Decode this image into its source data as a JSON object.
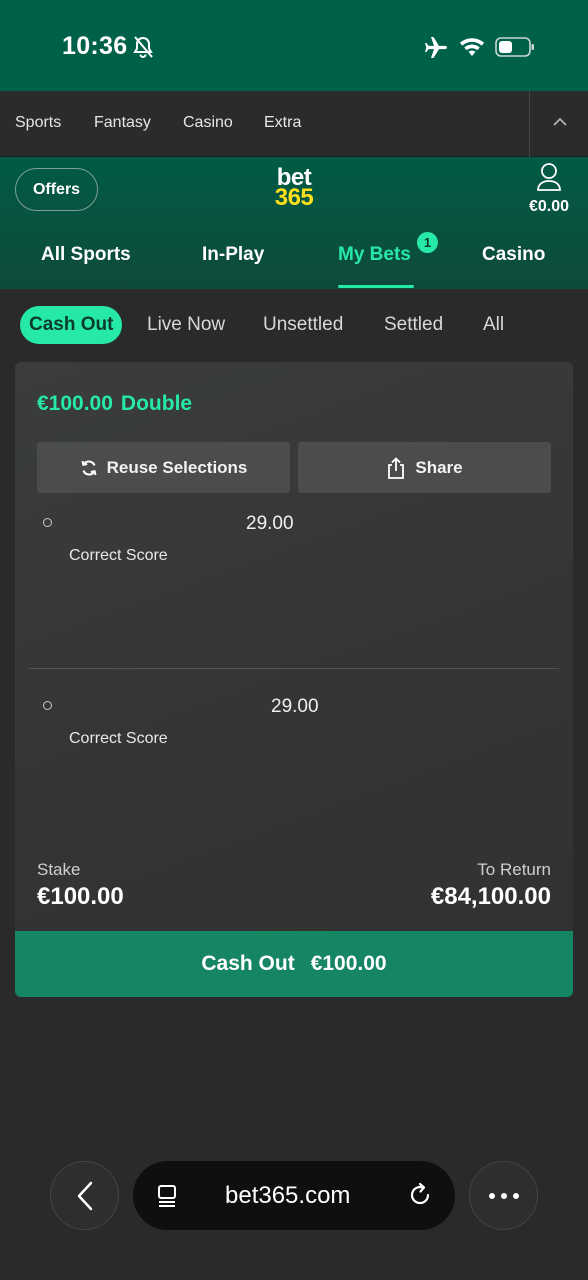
{
  "status_bar": {
    "time": "10:36"
  },
  "top_nav": {
    "items": [
      "Sports",
      "Fantasy",
      "Casino",
      "Extra"
    ]
  },
  "header": {
    "offers_label": "Offers",
    "logo_top": "bet",
    "logo_bottom": "365",
    "balance": "€0.00",
    "tabs": [
      "All Sports",
      "In-Play",
      "My Bets",
      "Casino"
    ],
    "active_tab": "My Bets",
    "my_bets_badge": "1"
  },
  "filters": {
    "items": [
      "Cash Out",
      "Live Now",
      "Unsettled",
      "Settled",
      "All"
    ],
    "active": "Cash Out"
  },
  "bet": {
    "stake_title": "€100.00",
    "type": "Double",
    "reuse_label": "Reuse Selections",
    "share_label": "Share",
    "selections": [
      {
        "odds": "29.00",
        "market": "Correct Score"
      },
      {
        "odds": "29.00",
        "market": "Correct Score"
      }
    ],
    "stake_label": "Stake",
    "stake_value": "€100.00",
    "return_label": "To Return",
    "return_value": "€84,100.00",
    "cashout_label": "Cash Out",
    "cashout_amount": "€100.00"
  },
  "browser": {
    "url": "bet365.com"
  },
  "colors": {
    "brand_green": "#00614a",
    "accent": "#26e8a7",
    "cashout": "#168563",
    "logo_yellow": "#ffdf1b"
  }
}
